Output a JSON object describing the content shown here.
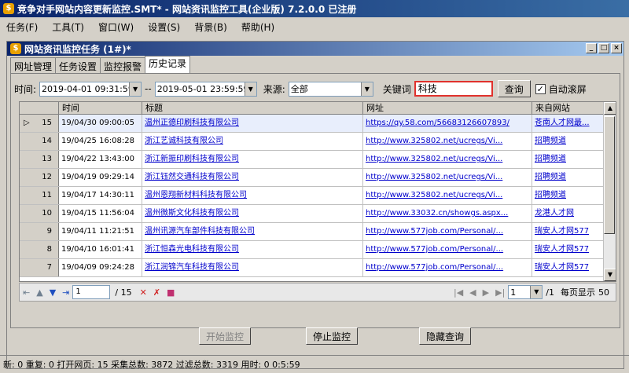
{
  "window": {
    "title": "竞争对手网站内容更新监控.SMT* - 网站资讯监控工具(企业版) 7.2.0.0  已注册"
  },
  "menu": [
    "任务(F)",
    "工具(T)",
    "窗口(W)",
    "设置(S)",
    "背景(B)",
    "帮助(H)"
  ],
  "child": {
    "title": "网站资讯监控任务  (1#)*"
  },
  "tabs": [
    "网址管理",
    "任务设置",
    "监控报警",
    "历史记录"
  ],
  "filters": {
    "time_label": "时间:",
    "start_time": "2019-04-01 09:31:59",
    "separator": "--",
    "end_time": "2019-05-01 23:59:59",
    "source_label": "来源:",
    "source_value": "全部",
    "keyword_label": "关键词",
    "keyword_value": "科技",
    "query_button": "查询",
    "autoscroll_label": "自动滚屏"
  },
  "table": {
    "headers": [
      "",
      "时间",
      "标题",
      "网址",
      "来自网站"
    ],
    "rows": [
      {
        "num": "15",
        "time": "19/04/30 09:00:05",
        "title": "温州正德印刷科技有限公司",
        "url": "https://qy.58.com/56683126607893/",
        "site": "苍南人才网最..."
      },
      {
        "num": "14",
        "time": "19/04/25 16:08:28",
        "title": "浙江艺诚科技有限公司",
        "url": "http://www.325802.net/ucregs/Vi...",
        "site": "招聘频道"
      },
      {
        "num": "13",
        "time": "19/04/22 13:43:00",
        "title": "浙江新振印刷科技有限公司",
        "url": "http://www.325802.net/ucregs/Vi...",
        "site": "招聘频道"
      },
      {
        "num": "12",
        "time": "19/04/19 09:29:14",
        "title": "浙江钰然交通科技有限公司",
        "url": "http://www.325802.net/ucregs/Vi...",
        "site": "招聘频道"
      },
      {
        "num": "11",
        "time": "19/04/17 14:30:11",
        "title": "温州恩翔新材料科技有限公司",
        "url": "http://www.325802.net/ucregs/Vi...",
        "site": "招聘频道"
      },
      {
        "num": "10",
        "time": "19/04/15 11:56:04",
        "title": "温州微斯文化科技有限公司",
        "url": "http://www.33032.cn/showgs.aspx...",
        "site": "龙港人才网"
      },
      {
        "num": "9",
        "time": "19/04/11 11:21:51",
        "title": "温州讯源汽车部件科技有限公司",
        "url": "http://www.577job.com/Personal/...",
        "site": "瑞安人才网577"
      },
      {
        "num": "8",
        "time": "19/04/10 16:01:41",
        "title": "浙江恒森光电科技有限公司",
        "url": "http://www.577job.com/Personal/...",
        "site": "瑞安人才网577"
      },
      {
        "num": "7",
        "time": "19/04/09 09:24:28",
        "title": "浙江润锦汽车科技有限公司",
        "url": "http://www.577job.com/Personal/...",
        "site": "瑞安人才网577"
      }
    ]
  },
  "pager": {
    "current": "1",
    "total": "/ 15",
    "page_num": "1",
    "page_total": "/1",
    "per_page_label": "每页显示",
    "per_page": "50"
  },
  "actions": {
    "start": "开始监控",
    "stop": "停止监控",
    "hide": "隐藏查询"
  },
  "status": "新: 0 重复: 0 打开网页: 15 采集总数: 3872 过滤总数: 3319 用时: 0 0:5:59"
}
